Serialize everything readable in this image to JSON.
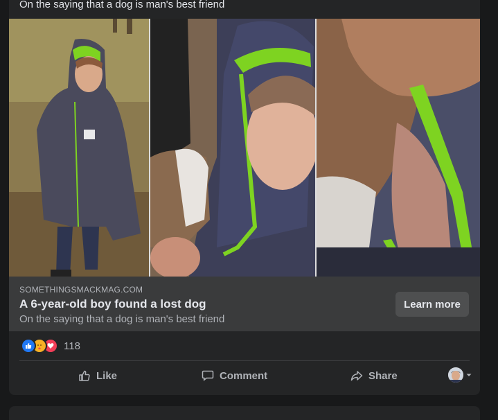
{
  "post": {
    "top_subtitle": "On the saying that a dog is man's best friend",
    "link": {
      "domain": "SOMETHINGSMACKMAG.COM",
      "headline": "A 6-year-old boy found a lost dog",
      "subtitle": "On the saying that a dog is man's best friend",
      "cta_label": "Learn more"
    },
    "reactions": {
      "icons": [
        "like-reaction-icon",
        "care-reaction-icon",
        "love-reaction-icon"
      ],
      "count": "118"
    },
    "actions": {
      "like_label": "Like",
      "comment_label": "Comment",
      "share_label": "Share"
    }
  },
  "colors": {
    "background": "#18191a",
    "card": "#242526",
    "link_bar": "#3a3b3c",
    "button": "#4e4f50",
    "text_primary": "#e4e6eb",
    "text_secondary": "#b0b3b8",
    "like_blue": "#2078f4",
    "love_red": "#f33e58",
    "care_yellow": "#f7b125"
  }
}
